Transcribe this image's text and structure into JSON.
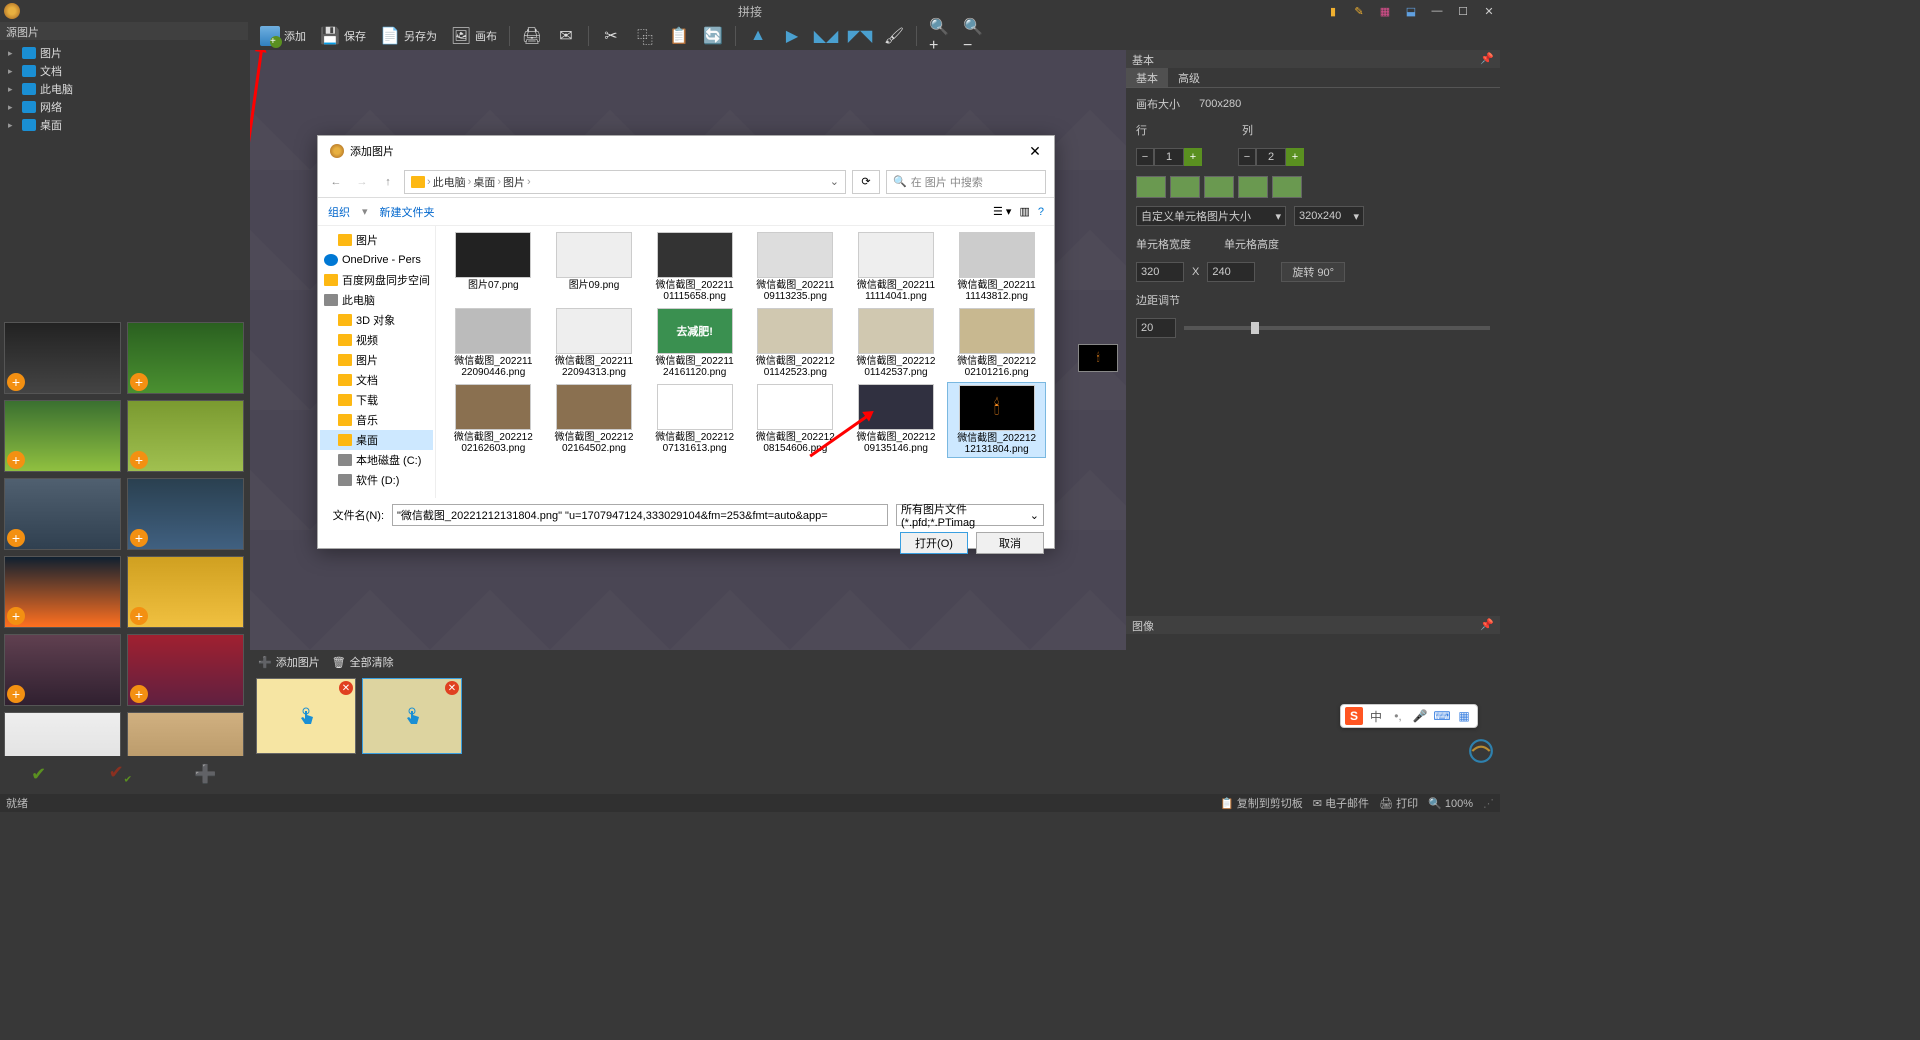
{
  "titlebar": {
    "title": "拼接"
  },
  "win_controls": {
    "min": "—",
    "max": "☐",
    "close": "✕"
  },
  "left_panel": {
    "header": "源图片",
    "tree": [
      "图片",
      "文档",
      "此电脑",
      "网络",
      "桌面"
    ]
  },
  "toolbar": {
    "add": "添加",
    "save": "保存",
    "saveas": "另存为",
    "canvas": "画布"
  },
  "strip": {
    "add": "添加图片",
    "clear": "全部清除"
  },
  "right_panel": {
    "basic_header": "基本",
    "tabs": {
      "basic": "基本",
      "advanced": "高级"
    },
    "canvas_size_label": "画布大小",
    "canvas_size_value": "700x280",
    "rows_label": "行",
    "cols_label": "列",
    "rows_value": "1",
    "cols_value": "2",
    "cellsize_mode": "自定义单元格图片大小",
    "cellsize_preset": "320x240",
    "width_label": "单元格宽度",
    "height_label": "单元格高度",
    "width_value": "320",
    "xsep": "X",
    "height_value": "240",
    "rotate_btn": "旋转  90°",
    "margin_label": "边距调节",
    "margin_value": "20",
    "image_header": "图像"
  },
  "statusbar": {
    "ready": "就绪",
    "clipboard": "复制到剪切板",
    "email": "电子邮件",
    "print": "打印",
    "zoom": "100%"
  },
  "dialog": {
    "title": "添加图片",
    "path": [
      "此电脑",
      "桌面",
      "图片"
    ],
    "search_placeholder": "在 图片 中搜索",
    "organize": "组织",
    "newfolder": "新建文件夹",
    "tree": [
      {
        "label": "图片",
        "type": "folder",
        "indent": 1
      },
      {
        "label": "OneDrive - Pers",
        "type": "cloud",
        "indent": 0
      },
      {
        "label": "百度网盘同步空间",
        "type": "folder",
        "indent": 0
      },
      {
        "label": "此电脑",
        "type": "drive",
        "indent": 0
      },
      {
        "label": "3D 对象",
        "type": "folder",
        "indent": 1
      },
      {
        "label": "视频",
        "type": "folder",
        "indent": 1
      },
      {
        "label": "图片",
        "type": "folder",
        "indent": 1
      },
      {
        "label": "文档",
        "type": "folder",
        "indent": 1
      },
      {
        "label": "下载",
        "type": "folder",
        "indent": 1
      },
      {
        "label": "音乐",
        "type": "folder",
        "indent": 1
      },
      {
        "label": "桌面",
        "type": "folder",
        "indent": 1,
        "selected": true
      },
      {
        "label": "本地磁盘 (C:)",
        "type": "drive",
        "indent": 1
      },
      {
        "label": "软件 (D:)",
        "type": "drive",
        "indent": 1
      }
    ],
    "files": [
      {
        "name": "图片07.png",
        "bg": "#222"
      },
      {
        "name": "图片09.png",
        "bg": "#eee"
      },
      {
        "name": "微信截图_20221101115658.png",
        "bg": "#333"
      },
      {
        "name": "微信截图_20221109113235.png",
        "bg": "#ddd"
      },
      {
        "name": "微信截图_20221111114041.png",
        "bg": "#eee"
      },
      {
        "name": "微信截图_20221111143812.png",
        "bg": "#ccc"
      },
      {
        "name": "微信截图_20221122090446.png",
        "bg": "#bbb"
      },
      {
        "name": "微信截图_20221122094313.png",
        "bg": "#eee"
      },
      {
        "name": "微信截图_20221124161120.png",
        "bg": "#3a9050",
        "text": "去减肥!"
      },
      {
        "name": "微信截图_20221201142523.png",
        "bg": "#d0c8b0"
      },
      {
        "name": "微信截图_20221201142537.png",
        "bg": "#d0c8b0"
      },
      {
        "name": "微信截图_20221202101216.png",
        "bg": "#c8b890"
      },
      {
        "name": "微信截图_20221202162603.png",
        "bg": "#8a7050"
      },
      {
        "name": "微信截图_20221202164502.png",
        "bg": "#8a7050"
      },
      {
        "name": "微信截图_20221207131613.png",
        "bg": "#fff"
      },
      {
        "name": "微信截图_20221208154606.png",
        "bg": "#fff"
      },
      {
        "name": "微信截图_20221209135146.png",
        "bg": "#303040"
      },
      {
        "name": "微信截图_20221212131804.png",
        "bg": "#000",
        "selected": true,
        "candle": true
      }
    ],
    "fname_label": "文件名(N):",
    "fname_value": "\"微信截图_20221212131804.png\" \"u=1707947124,333029104&fm=253&fmt=auto&app=",
    "filter": "所有图片文件 (*.pfd;*.PTimag",
    "open": "打开(O)",
    "cancel": "取消"
  },
  "ime": {
    "cn": "中"
  },
  "thumbs_bg": [
    "linear-gradient(#222,#444)",
    "linear-gradient(#2a6020,#4a9030)",
    "linear-gradient(#3a7030,#90c040)",
    "linear-gradient(#7a9a30,#a0c050)",
    "linear-gradient(#506070,#304050)",
    "linear-gradient(#2a4050,#406080)",
    "linear-gradient(#102030,#ff7020)",
    "linear-gradient(#d0a020,#f0c040)",
    "linear-gradient(#604050,#302030)",
    "linear-gradient(#a02030,#602040)",
    "linear-gradient(#eee,#ddd)",
    "linear-gradient(#d0b080,#b09060)"
  ]
}
